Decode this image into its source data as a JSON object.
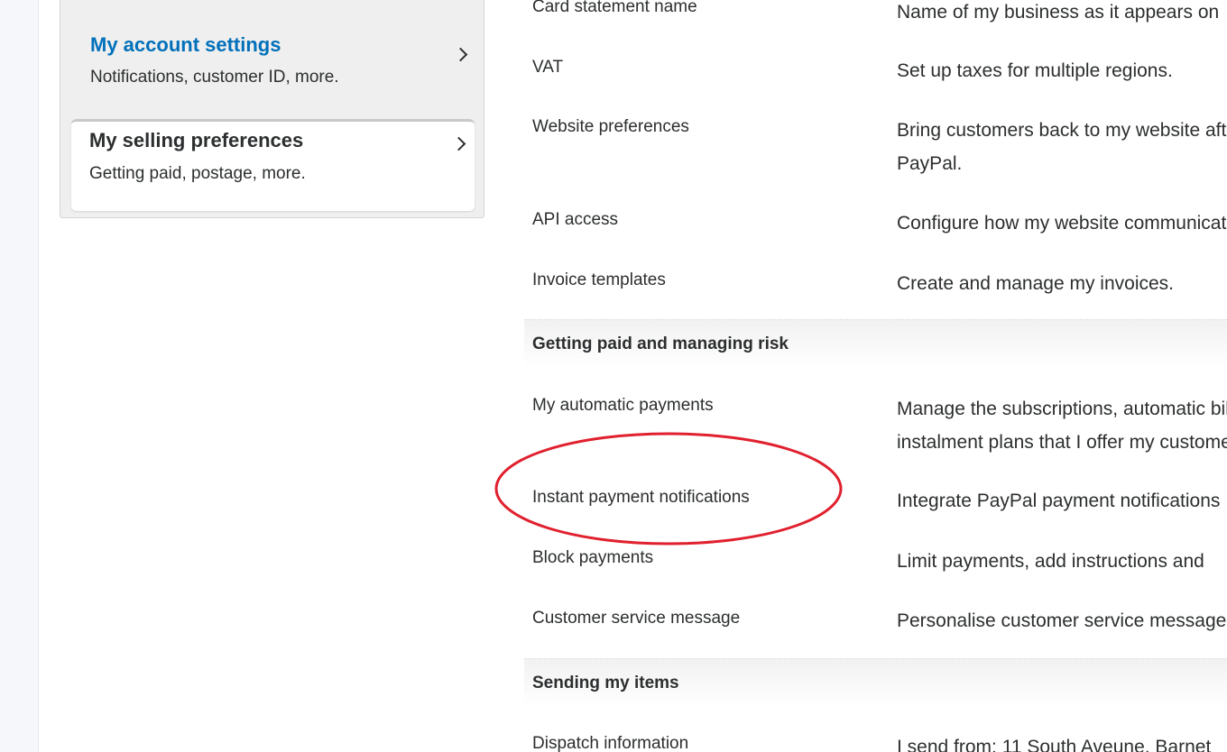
{
  "sidebar": {
    "account": {
      "title": "My account settings",
      "subtitle": "Notifications, customer ID, more."
    },
    "selling": {
      "title": "My selling preferences",
      "subtitle": "Getting paid, postage, more."
    }
  },
  "rows_top": [
    {
      "label": "Card statement name",
      "desc": "Name of my business as it appears on"
    },
    {
      "label": "VAT",
      "desc": "Set up taxes for multiple regions."
    },
    {
      "label": "Website preferences",
      "desc": "Bring customers back to my website after they pay with PayPal."
    },
    {
      "label": "API access",
      "desc": "Configure how my website communicates"
    },
    {
      "label": "Invoice templates",
      "desc": "Create and manage my invoices."
    }
  ],
  "sections": {
    "getting_paid": {
      "title": "Getting paid and managing risk",
      "rows": [
        {
          "label": "My automatic payments",
          "desc": "Manage the subscriptions, automatic billing and instalment plans that I offer my customers."
        },
        {
          "label": "Instant payment notifications",
          "desc": "Integrate PayPal payment notifications"
        },
        {
          "label": "Block payments",
          "desc": "Limit payments, add instructions and"
        },
        {
          "label": "Customer service message",
          "desc": "Personalise customer service message"
        }
      ]
    },
    "sending": {
      "title": "Sending my items",
      "rows": [
        {
          "label": "Dispatch information",
          "desc": "I send from: 11 South Aveune, Barnet"
        }
      ]
    }
  },
  "colors": {
    "link": "#0070ba",
    "highlight": "#e0202e"
  }
}
